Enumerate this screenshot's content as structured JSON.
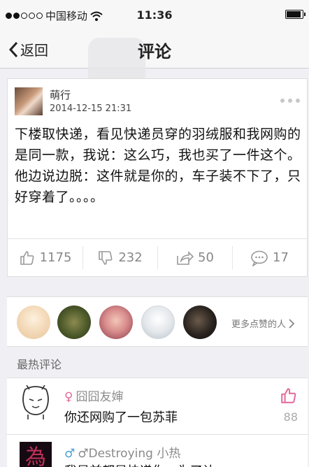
{
  "status_bar": {
    "carrier": "中国移动",
    "time": "11:36",
    "signal_level": 0.4,
    "battery_level": 0.85,
    "icons": [
      "signal-dots-icon",
      "wifi-icon",
      "battery-icon"
    ]
  },
  "nav": {
    "back_label": "返回",
    "title": "评论",
    "icons": [
      "chevron-left-icon"
    ]
  },
  "post": {
    "author": "萌行",
    "timestamp": "2014-12-15 21:31",
    "content": "下楼取快递，看见快递员穿的羽绒服和我网购的是同一款，我说：这么巧，我也买了一件这个。他边说边脱：这件就是你的，车子装不下了，只好穿着了。。。。",
    "actions": {
      "like_count": "1175",
      "dislike_count": "232",
      "share_count": "50",
      "comment_count": "17"
    },
    "icons": [
      "more-dots-icon",
      "thumbs-up-icon",
      "thumbs-down-icon",
      "share-icon",
      "comment-bubble-icon"
    ]
  },
  "likes": {
    "more_label": "更多点赞的人",
    "icons": [
      "chevron-right-icon"
    ]
  },
  "hot_comments": {
    "title": "最热评论",
    "items": [
      {
        "gender": "♀",
        "name": "囧囧友婶",
        "text": "你还网购了一包苏菲",
        "likes": "88"
      },
      {
        "gender": "♂",
        "name": "♂Destroying 小热",
        "text": "我是前都是快递你，为了让",
        "avatar_glyph": "為"
      }
    ]
  },
  "colors": {
    "background": "#efeff4",
    "accent_like": "#e2679a",
    "male": "#4aa0d8"
  }
}
